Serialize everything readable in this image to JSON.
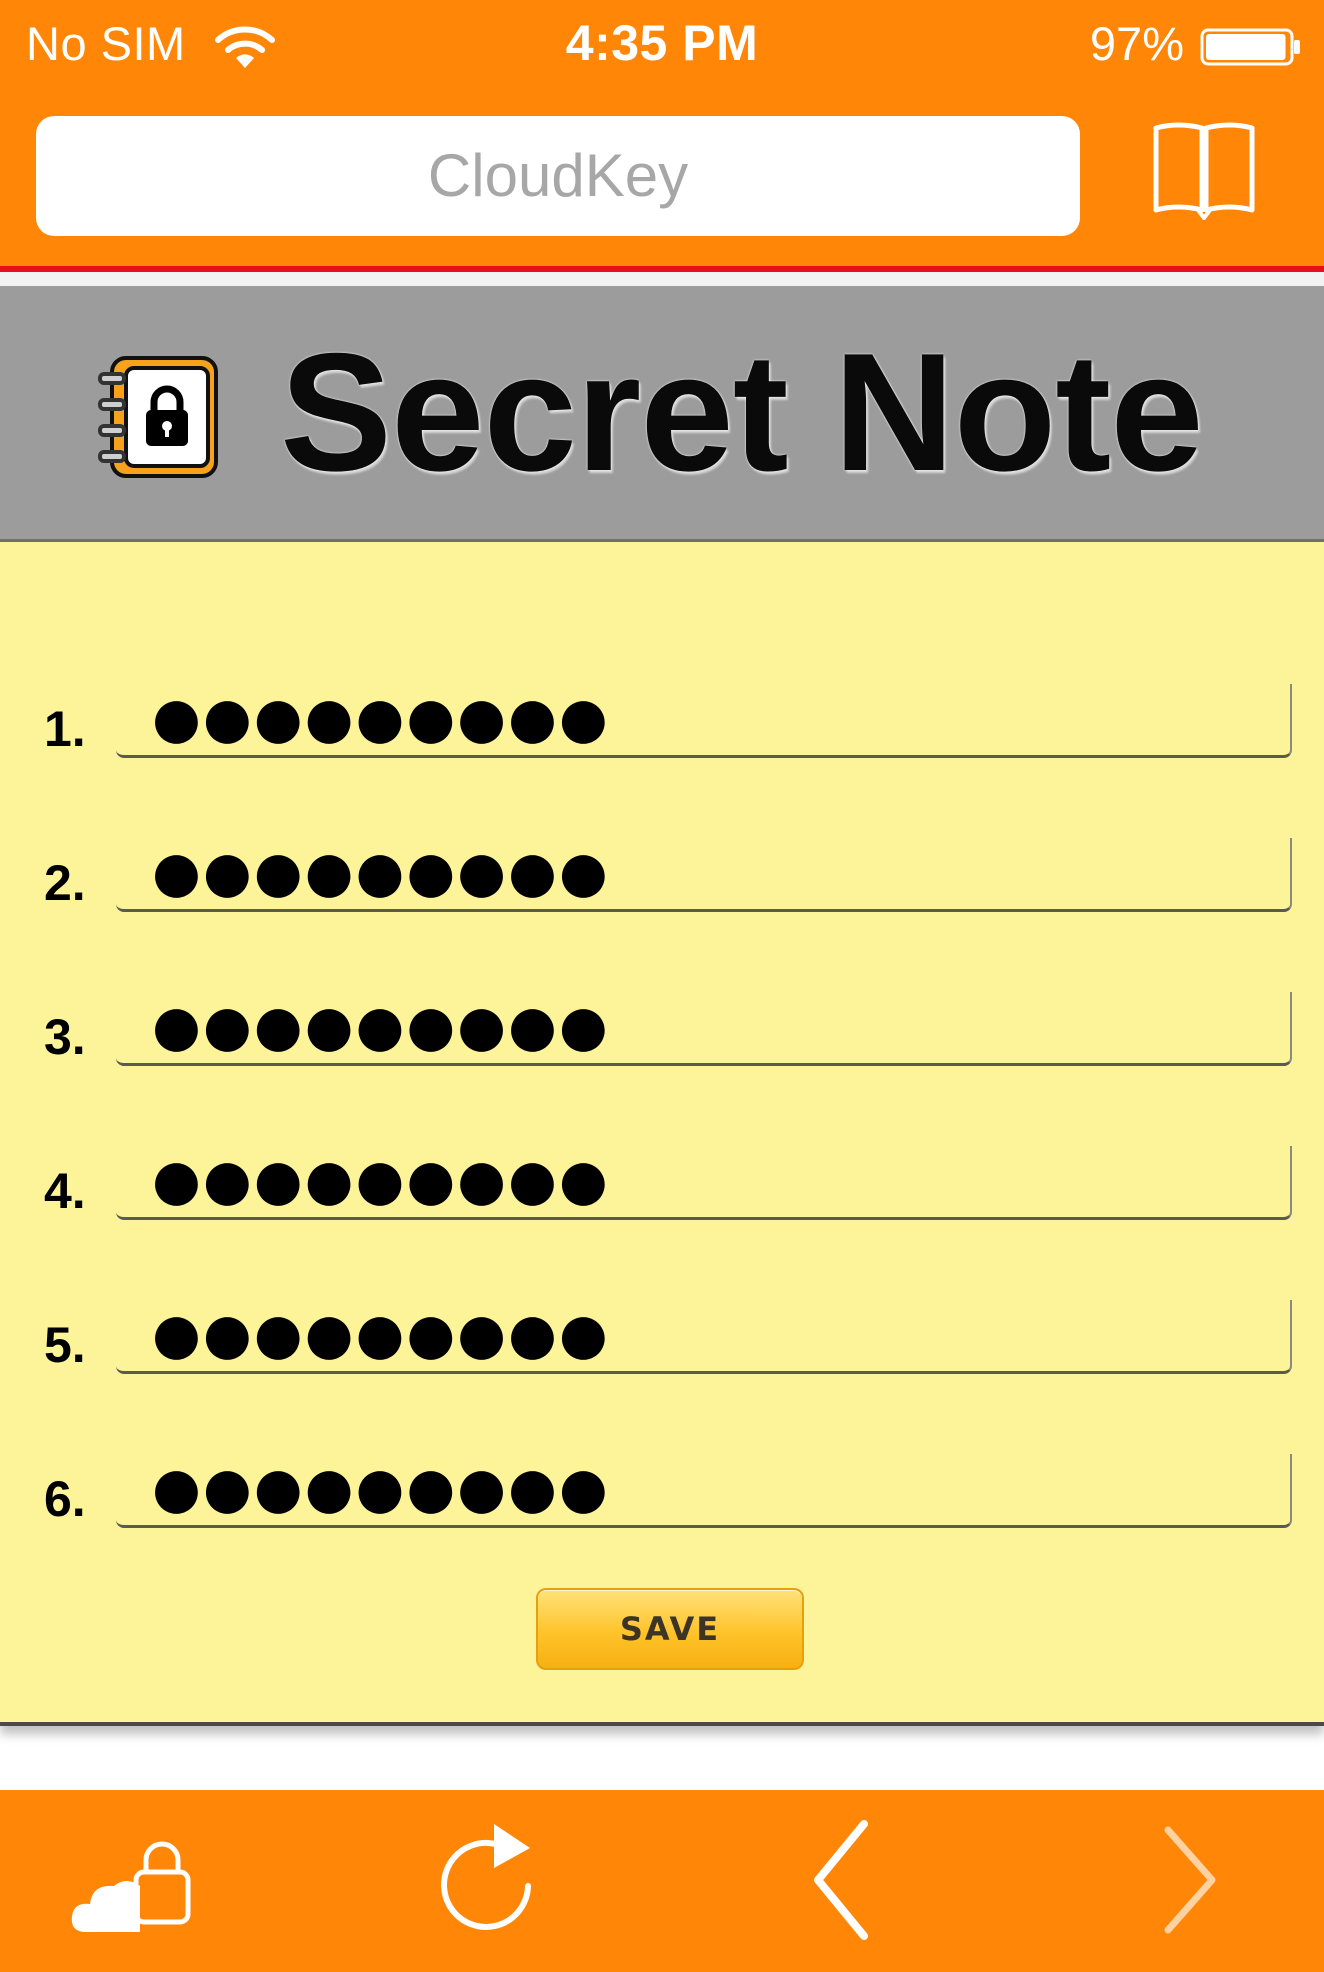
{
  "status_bar": {
    "carrier": "No SIM",
    "time": "4:35 PM",
    "battery_percent": "97%",
    "battery_level": 0.97
  },
  "browser": {
    "address_text": "CloudKey",
    "bookmarks_icon": "book-icon"
  },
  "banner": {
    "icon": "locked-notebook-icon",
    "title": "Secret Note"
  },
  "note": {
    "rows": [
      {
        "number": "1.",
        "value": "●●●●●●●●●"
      },
      {
        "number": "2.",
        "value": "●●●●●●●●●"
      },
      {
        "number": "3.",
        "value": "●●●●●●●●●"
      },
      {
        "number": "4.",
        "value": "●●●●●●●●●"
      },
      {
        "number": "5.",
        "value": "●●●●●●●●●"
      },
      {
        "number": "6.",
        "value": "●●●●●●●●●"
      }
    ],
    "save_label": "SAVE"
  },
  "toolbar": {
    "items": [
      {
        "icon": "cloud-lock-icon"
      },
      {
        "icon": "reload-icon"
      },
      {
        "icon": "back-arrow-icon"
      },
      {
        "icon": "forward-arrow-icon"
      }
    ]
  },
  "colors": {
    "bar_orange": "#ff8607",
    "banner_gray": "#9c9c9c",
    "note_yellow": "#fdf49a",
    "accent_red": "#e4101c",
    "save_gold": "#ffc32a"
  }
}
